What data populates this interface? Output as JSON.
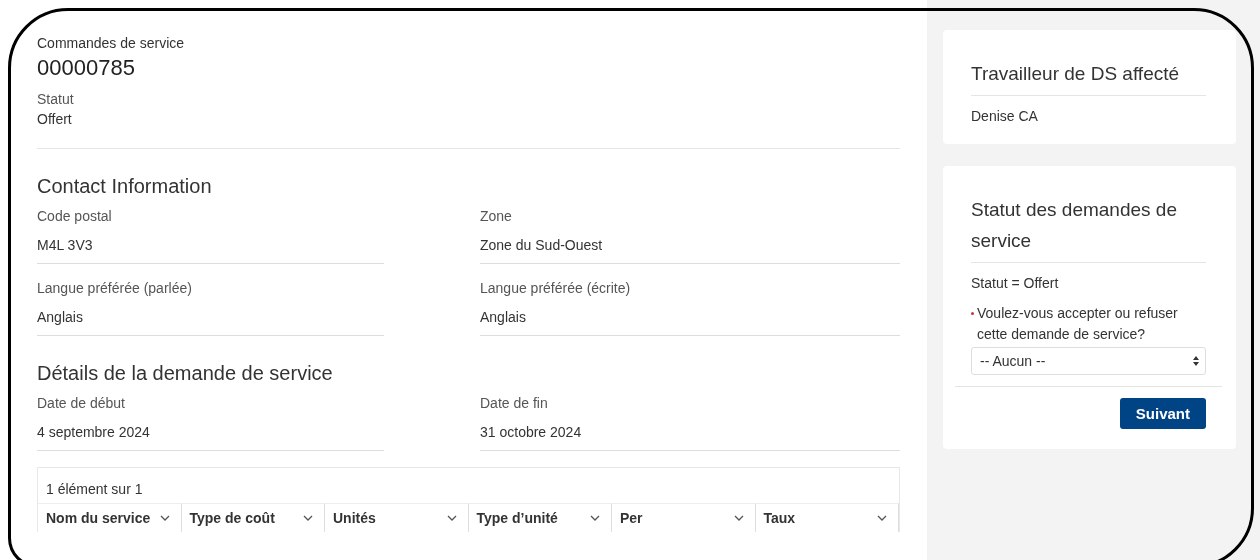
{
  "record": {
    "object_label": "Commandes de service",
    "number": "00000785",
    "status_label": "Statut",
    "status_value": "Offert"
  },
  "sections": [
    {
      "title": "Contact Information",
      "fields": [
        {
          "label": "Code postal",
          "value": "M4L 3V3"
        },
        {
          "label": "Zone",
          "value": "Zone du Sud-Ouest"
        },
        {
          "label": "Langue préférée (parlée)",
          "value": "Anglais"
        },
        {
          "label": "Langue préférée (écrite)",
          "value": "Anglais"
        }
      ]
    },
    {
      "title": "Détails de la demande de service",
      "fields": [
        {
          "label": "Date de début",
          "value": "4 septembre 2024"
        },
        {
          "label": "Date de fin",
          "value": "31 octobre 2024"
        }
      ]
    }
  ],
  "table": {
    "count": "1 élément sur 1",
    "columns": [
      "Nom du service",
      "Type de coût",
      "Unités",
      "Type d’unité",
      "Per",
      "Taux"
    ]
  },
  "assigned_worker": {
    "title": "Travailleur de DS affecté",
    "name": "Denise CA"
  },
  "request_status": {
    "title": "Statut des demandes de service",
    "status_text": "Statut = Offert",
    "question": {
      "label": "Voulez-vous accepter ou refuser cette demande de service?",
      "required": true
    },
    "select": {
      "value": "-- Aucun --"
    },
    "button": "Suivant"
  }
}
